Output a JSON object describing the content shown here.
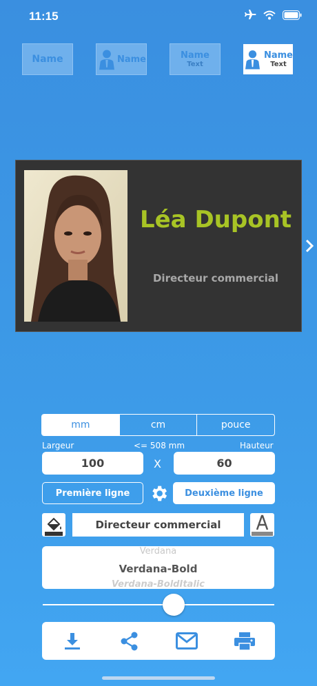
{
  "status": {
    "time": "11:15"
  },
  "templates": [
    {
      "line1": "Name",
      "line2": ""
    },
    {
      "line1": "Name",
      "line2": ""
    },
    {
      "line1": "Name",
      "line2": "Text"
    },
    {
      "line1": "Name",
      "line2": "Text"
    }
  ],
  "card": {
    "name": "Léa Dupont",
    "title": "Directeur commercial",
    "name_color": "#a8c425",
    "bg_color": "#333333"
  },
  "units": {
    "options": [
      "mm",
      "cm",
      "pouce"
    ],
    "selected": "mm"
  },
  "dimensions": {
    "width_label": "Largeur",
    "max_label": "<= 508 mm",
    "height_label": "Hauteur",
    "width_value": "100",
    "separator": "X",
    "height_value": "60"
  },
  "lines": {
    "first_label": "Première ligne",
    "second_label": "Deuxième ligne"
  },
  "text_field": {
    "value": "Directeur commercial"
  },
  "font_picker": {
    "prev": "Verdana",
    "selected": "Verdana-Bold",
    "next": "Verdana-BoldItalic"
  },
  "slider": {
    "value_fraction": 0.56
  },
  "actions": [
    "download-icon",
    "share-icon",
    "mail-icon",
    "print-icon"
  ],
  "colors": {
    "accent": "#3b8fe0",
    "background_top": "#3a8fe0",
    "background_bottom": "#42a6f2"
  }
}
